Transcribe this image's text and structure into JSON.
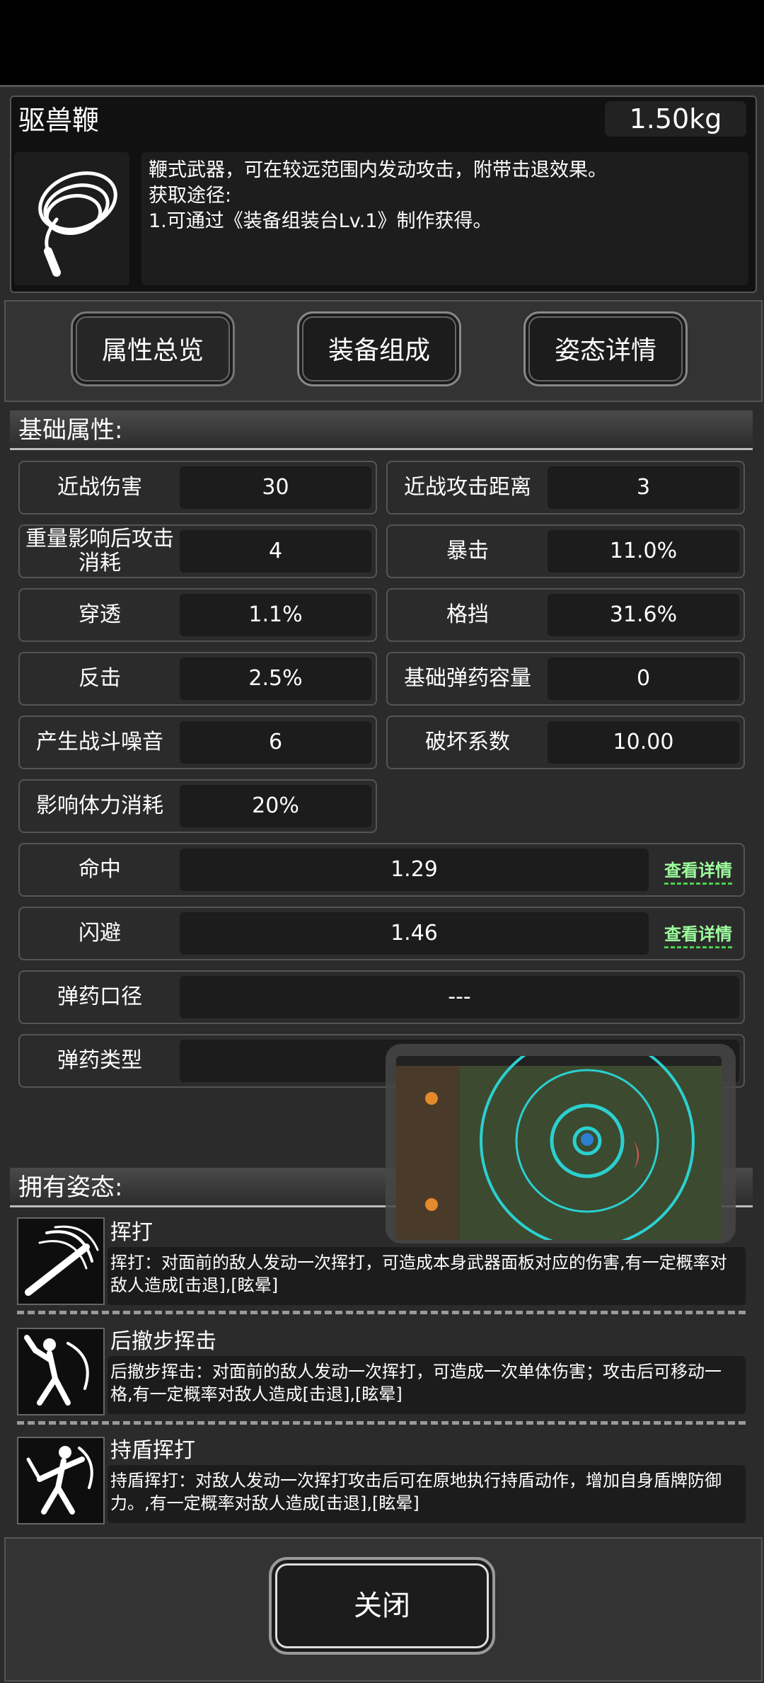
{
  "item": {
    "name": "驱兽鞭",
    "weight": "1.50kg",
    "description": [
      "鞭式武器，可在较远范围内发动攻击，附带击退效果。",
      "获取途径:",
      "1.可通过《装备组装台Lv.1》制作获得。"
    ],
    "icon": "whip-icon"
  },
  "tabs": [
    {
      "label": "属性总览"
    },
    {
      "label": "装备组成"
    },
    {
      "label": "姿态详情"
    }
  ],
  "basic_section_title": "基础属性:",
  "stats": [
    {
      "label": "近战伤害",
      "value": "30"
    },
    {
      "label": "近战攻击距离",
      "value": "3"
    },
    {
      "label": "重量影响后攻击消耗",
      "value": "4"
    },
    {
      "label": "暴击",
      "value": "11.0%"
    },
    {
      "label": "穿透",
      "value": "1.1%"
    },
    {
      "label": "格挡",
      "value": "31.6%"
    },
    {
      "label": "反击",
      "value": "2.5%"
    },
    {
      "label": "基础弹药容量",
      "value": "0"
    },
    {
      "label": "产生战斗噪音",
      "value": "6"
    },
    {
      "label": "破坏系数",
      "value": "10.00"
    },
    {
      "label": "影响体力消耗",
      "value": "20%"
    }
  ],
  "wide_stats": [
    {
      "label": "命中",
      "value": "1.29",
      "link": "查看详情"
    },
    {
      "label": "闪避",
      "value": "1.46",
      "link": "查看详情"
    },
    {
      "label": "弹药口径",
      "value": "---"
    },
    {
      "label": "弹药类型",
      "value": ""
    }
  ],
  "stance_section_title": "拥有姿态:",
  "stances": [
    {
      "name": "挥打",
      "desc": "挥打：对面前的敌人发动一次挥打，可造成本身武器面板对应的伤害,有一定概率对敌人造成[击退],[眩晕]",
      "icon": "swing-icon"
    },
    {
      "name": "后撤步挥击",
      "desc": "后撤步挥击：对面前的敌人发动一次挥打，可造成一次单体伤害；攻击后可移动一格,有一定概率对敌人造成[击退],[眩晕]",
      "icon": "backstep-swing-icon"
    },
    {
      "name": "持盾挥打",
      "desc": "持盾挥打：对敌人发动一次挥打攻击后可在原地执行持盾动作，增加自身盾牌防御力。,有一定概率对敌人造成[击退],[眩晕]",
      "icon": "shield-swing-icon"
    }
  ],
  "close_label": "关闭",
  "colors": {
    "accent_link": "#9dff9d",
    "panel": "#2b2b2b"
  }
}
